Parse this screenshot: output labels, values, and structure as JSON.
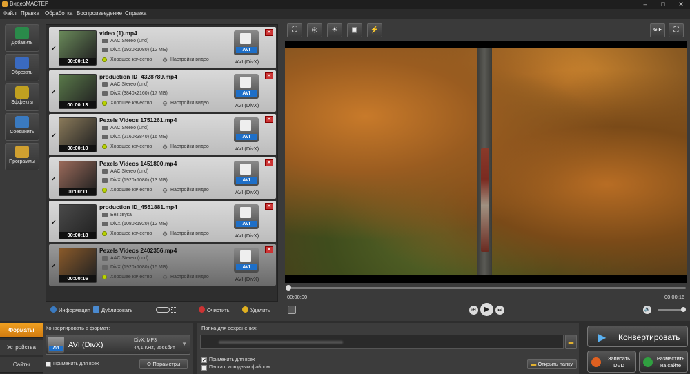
{
  "window": {
    "title": "ВидеоМАСТЕР",
    "minimize": "–",
    "maximize": "□",
    "close": "✕"
  },
  "menu": [
    "Файл",
    "Правка",
    "Обработка",
    "Воспроизведение",
    "Справка"
  ],
  "sidebar": [
    {
      "label": "Добавить",
      "icon": "add-video-icon",
      "color": "#2a8a4a"
    },
    {
      "label": "Обрезать",
      "icon": "cut-icon",
      "color": "#3a6ac0"
    },
    {
      "label": "Эффекты",
      "icon": "effects-icon",
      "color": "#c0a020"
    },
    {
      "label": "Соединить",
      "icon": "join-icon",
      "color": "#3a7ac0"
    },
    {
      "label": "Программы",
      "icon": "programs-icon",
      "color": "#d0a030"
    }
  ],
  "files": [
    {
      "name": "video (1).mp4",
      "audio": "AAC Stereo (und)",
      "video": "DivX (1920x1080) (12 МБ)",
      "quality": "Хорошее качество",
      "settings": "Настройки видео",
      "duration": "00:00:12",
      "format_badge": "AVI",
      "format": "AVI (DivX)",
      "thumb": "#6a8a5a",
      "checked": "✔"
    },
    {
      "name": "production ID_4328789.mp4",
      "audio": "AAC Stereo (und)",
      "video": "DivX (3840x2160) (17 МБ)",
      "quality": "Хорошее качество",
      "settings": "Настройки видео",
      "duration": "00:00:13",
      "format_badge": "AVI",
      "format": "AVI (DivX)",
      "thumb": "#5a7a4a",
      "checked": "✔"
    },
    {
      "name": "Pexels Videos 1751261.mp4",
      "audio": "AAC Stereo (und)",
      "video": "DivX (2160x3840) (16 МБ)",
      "quality": "Хорошее качество",
      "settings": "Настройки видео",
      "duration": "00:00:10",
      "format_badge": "AVI",
      "format": "AVI (DivX)",
      "thumb": "#8a7a5a",
      "checked": "✔"
    },
    {
      "name": "Pexels Videos 1451800.mp4",
      "audio": "AAC Stereo (und)",
      "video": "DivX (1920x1080) (13 МБ)",
      "quality": "Хорошее качество",
      "settings": "Настройки видео",
      "duration": "00:00:11",
      "format_badge": "AVI",
      "format": "AVI (DivX)",
      "thumb": "#9a6a5a",
      "checked": "✔"
    },
    {
      "name": "production ID_4551881.mp4",
      "audio": "Без звука",
      "video": "DivX (1080x1920) (12 МБ)",
      "quality": "Хорошее качество",
      "settings": "Настройки видео",
      "duration": "00:00:18",
      "format_badge": "AVI",
      "format": "AVI (DivX)",
      "thumb": "#4a4a4a",
      "checked": "✔"
    },
    {
      "name": "Pexels Videos 2402356.mp4",
      "audio": "AAC Stereo (und)",
      "video": "DivX (1920x1080) (15 МБ)",
      "quality": "Хорошее качество",
      "settings": "Настройки видео",
      "duration": "00:00:16",
      "format_badge": "AVI",
      "format": "AVI (DivX)",
      "thumb": "#8a5a2a",
      "checked": "✔"
    }
  ],
  "list_actions": {
    "info": "Информация",
    "duplicate": "Дублировать",
    "clear": "Очистить",
    "delete": "Удалить"
  },
  "toolbar": {
    "gif": "GIF"
  },
  "player": {
    "current": "00:00:00",
    "total": "00:00:16",
    "progress": 0,
    "volume": 0.95
  },
  "bottom": {
    "tabs": [
      "Форматы",
      "Устройства",
      "Сайты"
    ],
    "convert_to_label": "Конвертировать в формат:",
    "format_badge": "AVI",
    "format_name": "AVI (DivX)",
    "format_codec": "DivX, MP3",
    "format_audio": "44,1 KHz, 256Кбит",
    "apply_all": "Применить для всех",
    "params": "Параметры",
    "save_folder_label": "Папка для сохранения:",
    "apply_all_save": "Применить для всех",
    "same_folder": "Папка с исходным файлом",
    "open_folder": "Открыть папку",
    "apply_all_save_checked": "✔",
    "convert": "Конвертировать",
    "burn_dvd": "Записать DVD",
    "publish": "Разместить на сайте"
  }
}
